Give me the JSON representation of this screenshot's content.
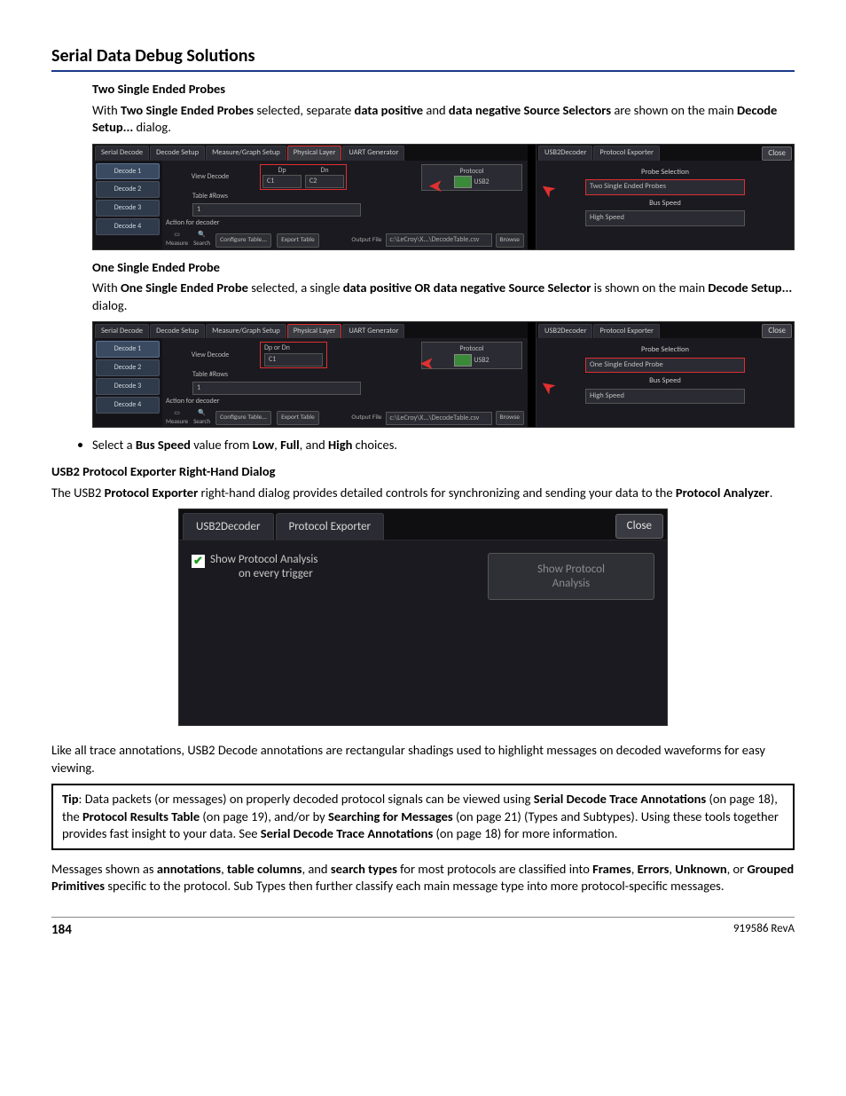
{
  "page": {
    "title": "Serial Data Debug Solutions",
    "number": "184",
    "rev": "919586 RevA"
  },
  "section1": {
    "heading": "Two Single Ended Probes",
    "para_parts": [
      "With ",
      "Two Single Ended Probes",
      " selected, separate ",
      "data positive",
      " and ",
      "data negative Source Selectors",
      " are shown on the main ",
      "Decode Setup...",
      " dialog."
    ]
  },
  "section2": {
    "heading": "One Single Ended Probe",
    "para_parts": [
      "With ",
      "One Single Ended Probe",
      " selected, a single ",
      "data positive OR data negative Source Selector",
      " is shown on the main ",
      "Decode Setup...",
      " dialog."
    ]
  },
  "bullet": {
    "parts": [
      "Select a ",
      "Bus Speed",
      " value from ",
      "Low",
      ", ",
      "Full",
      ", and ",
      "High",
      " choices."
    ]
  },
  "section3": {
    "heading": "USB2 Protocol Exporter Right-Hand Dialog",
    "para_parts": [
      "The USB2 ",
      "Protocol Exporter",
      " right-hand dialog provides detailed controls for synchronizing and sending your data to the ",
      "Protocol Analyzer",
      "."
    ]
  },
  "after_big": {
    "para": "Like all trace annotations, USB2 Decode annotations are rectangular shadings used to highlight messages on decoded waveforms for easy viewing."
  },
  "tip": {
    "parts": [
      "Tip",
      ": Data packets (or messages) on properly decoded protocol signals can be viewed using ",
      "Serial Decode Trace Annotations",
      " (on page 18), the ",
      "Protocol Results Table",
      " (on page 19), and/or by ",
      "Searching for Messages",
      " (on page 21) (Types and Subtypes). Using these tools together provides fast insight to your data. See ",
      "Serial Decode Trace Annotations",
      " (on page 18) for more information."
    ]
  },
  "final": {
    "parts": [
      "Messages shown as ",
      "annotations",
      ", ",
      "table columns",
      ", and ",
      "search types",
      " for most protocols are classified into ",
      "Frames",
      ", ",
      "Errors",
      ", ",
      "Unknown",
      ", or ",
      "Grouped Primitives",
      " specific to the protocol. Sub Types then further classify each main message type into more protocol-specific messages."
    ]
  },
  "ss": {
    "tabs_left": [
      "Serial Decode",
      "Decode Setup",
      "Measure/Graph Setup",
      "Physical Layer",
      "UART Generator"
    ],
    "tabs_right": [
      "USB2Decoder",
      "Protocol Exporter"
    ],
    "close": "Close",
    "decode_btns": [
      "Decode 1",
      "Decode 2",
      "Decode 3",
      "Decode 4"
    ],
    "view_decode": "View Decode",
    "table_rows": "Table #Rows",
    "table_rows_val": "1",
    "action": "Action for decoder",
    "dp": "Dp",
    "dn": "Dn",
    "dp_or_dn": "Dp or Dn",
    "c1": "C1",
    "c2": "C2",
    "protocol": "Protocol",
    "usb2": "USB2",
    "measure": "Measure",
    "search": "Search",
    "configure": "Configure Table...",
    "export": "Export Table",
    "output_file": "Output File",
    "output_path": "c:\\LeCroy\\X...\\DecodeTable.csv",
    "browse": "Browse",
    "probe_selection": "Probe Selection",
    "two_probes": "Two Single Ended Probes",
    "one_probe": "One Single Ended Probe",
    "bus_speed": "Bus Speed",
    "high_speed": "High Speed"
  },
  "big": {
    "tab1": "USB2Decoder",
    "tab2": "Protocol Exporter",
    "close": "Close",
    "chk_l1": "Show Protocol Analysis",
    "chk_l2": "on every trigger",
    "btn_l1": "Show Protocol",
    "btn_l2": "Analysis"
  }
}
